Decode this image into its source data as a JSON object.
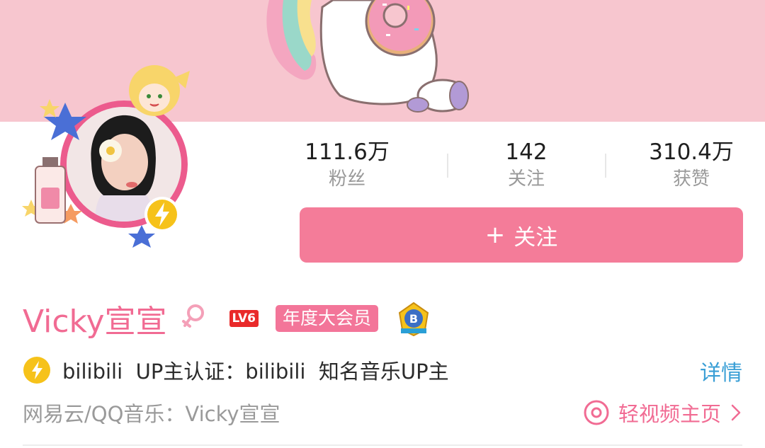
{
  "banner": {
    "icon": "unicorn-donut-illustration"
  },
  "avatar": {
    "icon": "avatar-photo",
    "badge_icon": "lightning-verified-icon"
  },
  "stats": [
    {
      "value": "111.6万",
      "label": "粉丝"
    },
    {
      "value": "142",
      "label": "关注"
    },
    {
      "value": "310.4万",
      "label": "获赞"
    }
  ],
  "follow_button": {
    "plus": "+",
    "label": "关注"
  },
  "profile": {
    "name": "Vicky宣宣",
    "gender_icon": "female-icon",
    "level": "LV6",
    "vip_label": "年度大会员",
    "medal_icon": "medal-icon"
  },
  "verification": {
    "text": "bilibili  UP主认证：bilibili  知名音乐UP主",
    "detail_label": "详情"
  },
  "music": {
    "text": "网易云/QQ音乐：Vicky宣宣",
    "short_video_label": "轻视频主页"
  },
  "colors": {
    "accent_pink": "#f16b93",
    "button_pink": "#f47c99",
    "banner_pink": "#f7c6cf",
    "link_blue": "#3a9fd6",
    "level_red": "#e92a2a"
  }
}
